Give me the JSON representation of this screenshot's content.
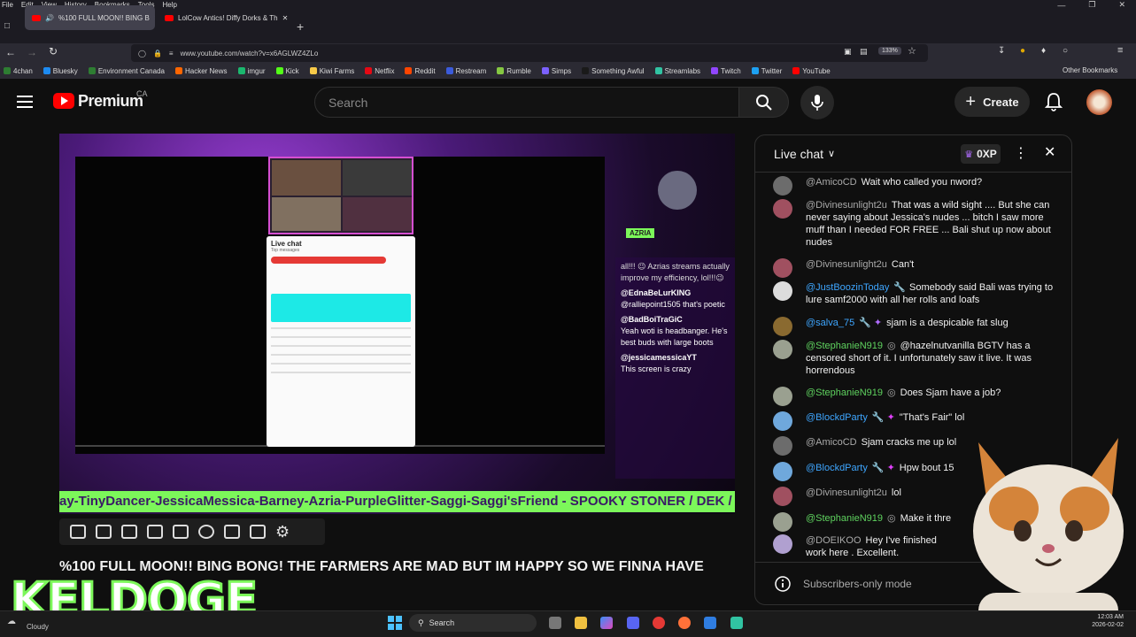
{
  "menubar": [
    "File",
    "Edit",
    "View",
    "History",
    "Bookmarks",
    "Tools",
    "Help"
  ],
  "tabs": [
    {
      "label": "%100 FULL MOON!! BING B"
    },
    {
      "label": "LolCow Antics! Diffy Dorks & Th"
    }
  ],
  "url": "www.youtube.com/watch?v=x6AGLWZ4ZLo",
  "zoom": "133%",
  "bookmarks": [
    "4chan",
    "Bluesky",
    "Environment Canada",
    "Hacker News",
    "imgur",
    "Kick",
    "Kiwi Farms",
    "Netflix",
    "Reddit",
    "Restream",
    "Rumble",
    "Simps",
    "Something Awful",
    "Streamlabs",
    "Twitch",
    "Twitter",
    "YouTube"
  ],
  "other_bookmarks": "Other Bookmarks",
  "bookmark_colors": [
    "#2e7d32",
    "#1d8bf1",
    "#2e7d32",
    "#ff6600",
    "#1bb76e",
    "#53fc18",
    "#f7c948",
    "#e50914",
    "#ff4500",
    "#3b5bdb",
    "#85c742",
    "#7b61ff",
    "#1a1a1a",
    "#31c3a2",
    "#9146ff",
    "#1da1f2",
    "#ff0000"
  ],
  "youtube": {
    "logo_text": "Premium",
    "region": "CA",
    "search_placeholder": "Search",
    "create_label": "Create"
  },
  "video": {
    "inner_chat_title": "Live chat",
    "inner_chat_sub": "Top messages",
    "azria_tag": "AZRIA",
    "overlay_lines": [
      {
        "user": "",
        "text": "all!!! 😉 Azrias streams actually improve my efficiency, lol!!!😉"
      },
      {
        "user": "@EdnaBeLurKING",
        "text": "@ralliepoint1505 that's poetic"
      },
      {
        "user": "@BadBoiTraGiC",
        "text": "Yeah woti is headbanger. He's best buds with large boots"
      },
      {
        "user": "@jessicamessicaYT",
        "text": "This screen is crazy"
      }
    ],
    "ticker": "ay-TinyDancer-JessicaMessica-Barney-Azria-PurpleGlitter-Saggi-Saggi'sFriend - SPOOKY STONER / DEK /",
    "title": "%100 FULL MOON!! BING BONG! THE FARMERS ARE MAD BUT IM HAPPY SO WE FINNA HAVE"
  },
  "chat": {
    "header": "Live chat",
    "xp": "0XP",
    "footer": "Subscribers-only mode",
    "messages": [
      {
        "author": "@AmicoCD",
        "color": "grey",
        "text": "Wait who called you nword?"
      },
      {
        "author": "@Divinesunlight2u",
        "color": "grey",
        "text": "That was a wild sight .... But she can never saying about Jessica's nudes ... bitch I saw more muff than I needed FOR FREE ... Bali shut up now about nudes"
      },
      {
        "author": "@Divinesunlight2u",
        "color": "grey",
        "text": "Can't"
      },
      {
        "author": "@JustBoozinToday",
        "color": "blue",
        "text": "Somebody said Bali was trying to lure samf2000 with all her rolls and loafs"
      },
      {
        "author": "@salva_75",
        "color": "blue",
        "text": "sjam is a despicable fat slug"
      },
      {
        "author": "@StephanieN919",
        "color": "green",
        "text": "@hazelnutvanilla BGTV has a censored short of it. I unfortunately saw it live. It was horrendous"
      },
      {
        "author": "@StephanieN919",
        "color": "green",
        "text": "Does Sjam have a job?"
      },
      {
        "author": "@BlockdParty",
        "color": "blue",
        "text": "\"That's Fair\" lol"
      },
      {
        "author": "@AmicoCD",
        "color": "grey",
        "text": "Sjam cracks me up lol"
      },
      {
        "author": "@BlockdParty",
        "color": "blue",
        "text": "Hpw bout 15"
      },
      {
        "author": "@Divinesunlight2u",
        "color": "grey",
        "text": "lol"
      },
      {
        "author": "@StephanieN919",
        "color": "green",
        "text": "Make it thre"
      },
      {
        "author": "@DOEIKOO",
        "color": "grey",
        "text": "Hey I've finished work here . Excellent."
      }
    ]
  },
  "overlay_brand": "KELDOGE",
  "taskbar": {
    "weather": "Cloudy",
    "search": "Search",
    "time": "12:03 AM",
    "date": "2026-02-02"
  }
}
